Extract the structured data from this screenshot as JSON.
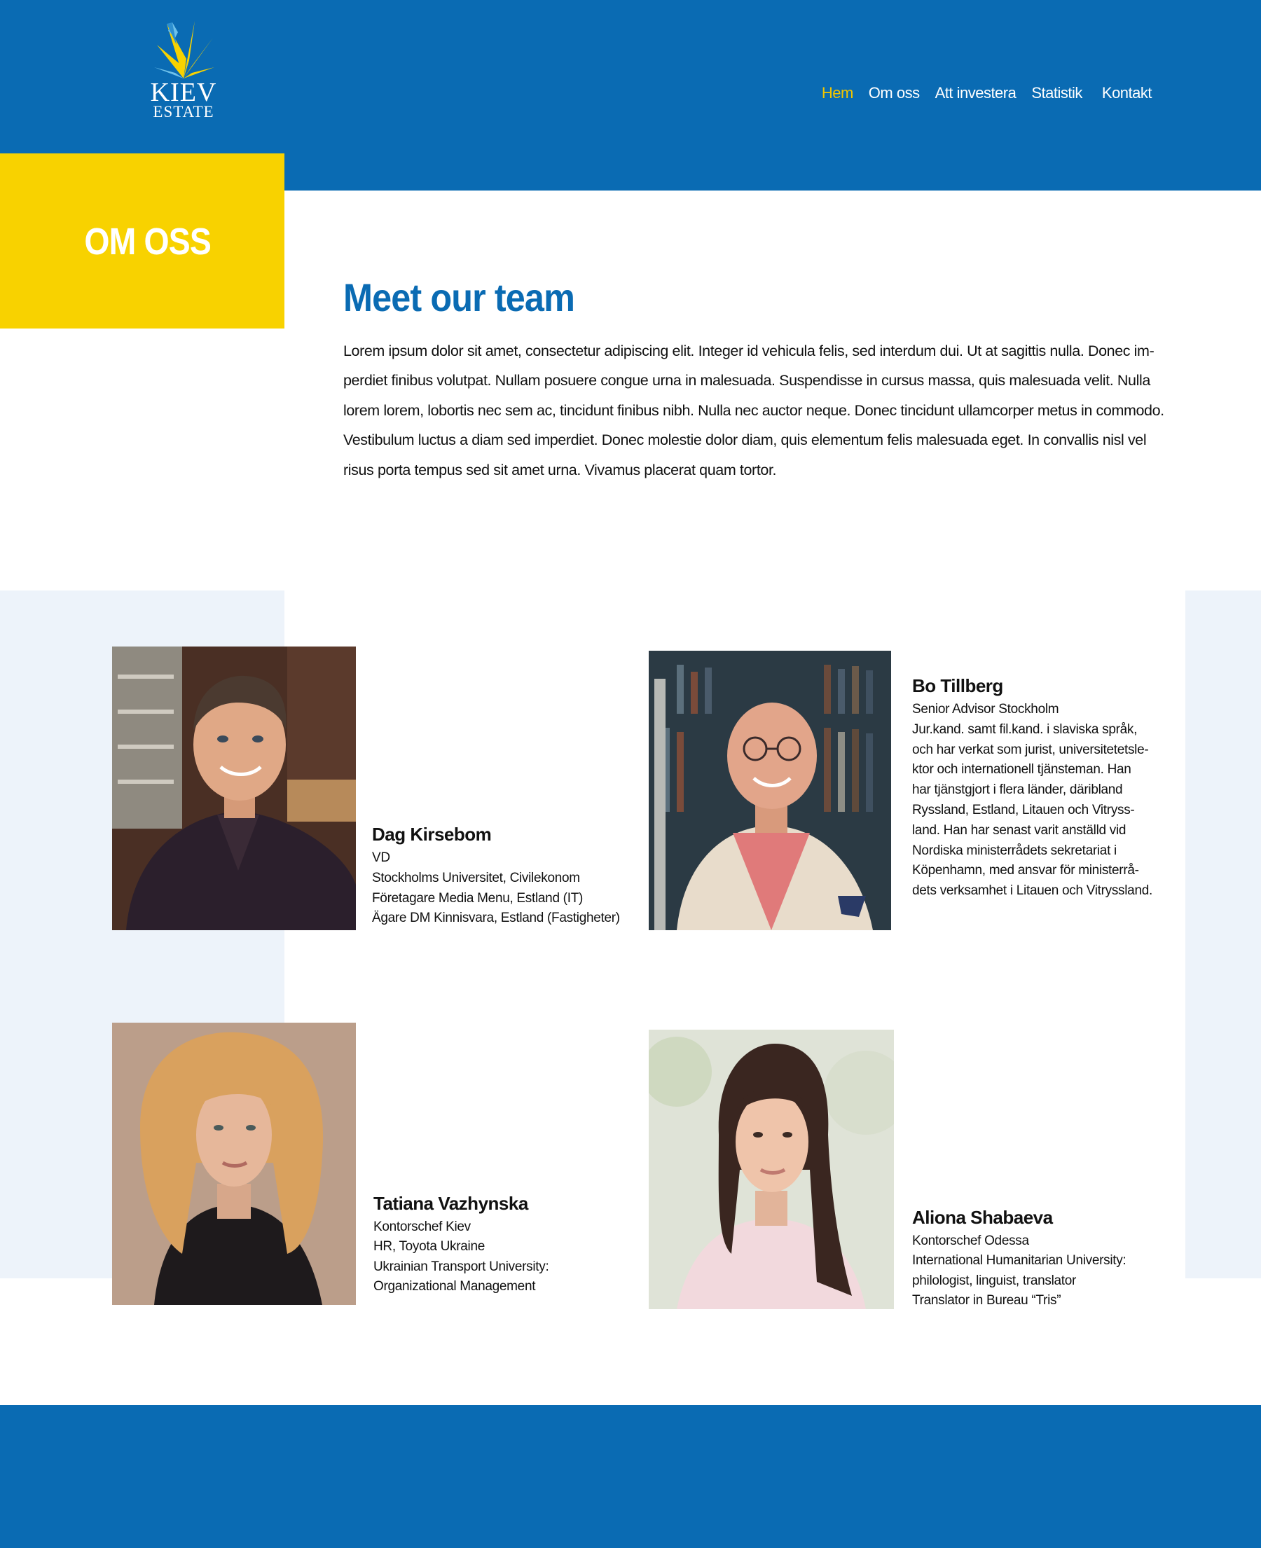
{
  "brand": {
    "line1": "KIEV",
    "line2": "ESTATE",
    "colors": {
      "blue": "#0a6bb3",
      "yellow": "#f8d200"
    }
  },
  "nav": {
    "items": [
      "Hem",
      "Om oss",
      "Att investera",
      "Statistik",
      "Kontakt"
    ],
    "active": "Hem"
  },
  "page": {
    "section_label": "OM OSS",
    "title": "Meet our team",
    "intro_lines": [
      "Lorem ipsum dolor sit amet, consectetur adipiscing elit. Integer id vehicula felis, sed interdum dui. Ut at sagittis nulla. Donec im-",
      "perdiet finibus volutpat. Nullam posuere congue urna in malesuada. Suspendisse in cursus massa, quis malesuada velit. Nulla",
      "lorem lorem, lobortis nec sem ac, tincidunt finibus nibh. Nulla nec auctor neque. Donec tincidunt ullamcorper metus in commodo.",
      "Vestibulum luctus a diam sed imperdiet. Donec molestie dolor diam, quis elementum felis malesuada eget. In convallis nisl vel",
      "risus porta tempus sed sit amet urna. Vivamus placerat quam tortor."
    ]
  },
  "team": [
    {
      "name": "Dag Kirsebom",
      "lines": [
        "VD",
        "Stockholms Universitet, Civilekonom",
        "Företagare Media Menu, Estland (IT)",
        "Ägare DM Kinnisvara, Estland (Fastigheter)"
      ]
    },
    {
      "name": "Bo Tillberg",
      "lines": [
        "Senior Advisor Stockholm",
        "Jur.kand. samt  fil.kand. i slaviska språk,",
        "och har verkat som jurist, universitetetsle-",
        "ktor och internationell tjänsteman. Han",
        "har tjänstgjort i flera länder, däribland",
        "Ryssland, Estland, Litauen och Vitryss-",
        "land. Han har senast varit anställd vid",
        "Nordiska ministerrådets sekretariat i",
        "Köpenhamn, med ansvar för ministerrå-",
        "dets verksamhet i Litauen och Vitryssland."
      ]
    },
    {
      "name": "Tatiana Vazhynska",
      "lines": [
        "Kontorschef Kiev",
        "HR, Toyota Ukraine",
        "Ukrainian Transport University:",
        "Organizational Management"
      ]
    },
    {
      "name": "Aliona Shabaeva",
      "lines": [
        "Kontorschef Odessa",
        "International Humanitarian University:",
        "philologist, linguist, translator",
        "Translator in Bureau “Tris”"
      ]
    }
  ]
}
